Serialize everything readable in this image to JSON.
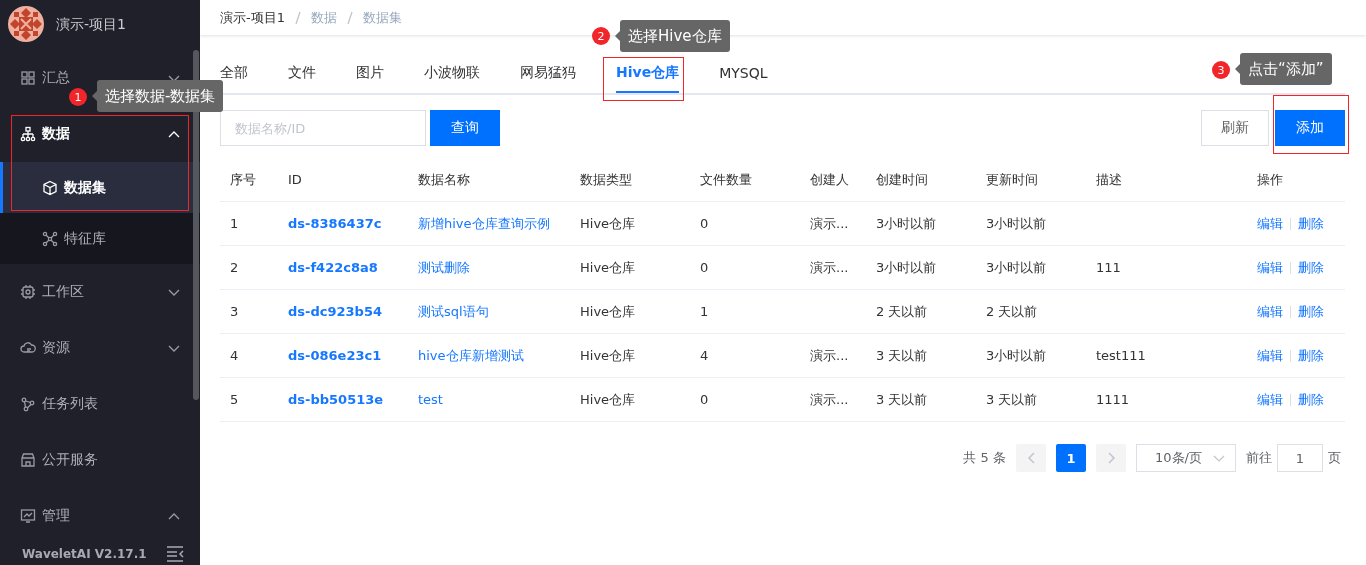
{
  "project": {
    "name": "演示-项目1"
  },
  "sidebar": {
    "items": [
      {
        "label": "汇总",
        "selected": false,
        "expanded": false
      },
      {
        "label": "数据",
        "selected": true,
        "expanded": true,
        "children": [
          {
            "label": "数据集",
            "selected": true
          },
          {
            "label": "特征库",
            "selected": false
          }
        ]
      },
      {
        "label": "工作区",
        "selected": false,
        "expanded": false
      },
      {
        "label": "资源",
        "selected": false,
        "expanded": false
      },
      {
        "label": "任务列表",
        "selected": false
      },
      {
        "label": "公开服务",
        "selected": false
      },
      {
        "label": "管理",
        "selected": false,
        "expanded": true
      }
    ],
    "version": "WaveletAI V2.17.1"
  },
  "breadcrumb": [
    "演示-项目1",
    "数据",
    "数据集"
  ],
  "tabs": [
    {
      "label": "全部",
      "selected": false
    },
    {
      "label": "文件",
      "selected": false
    },
    {
      "label": "图片",
      "selected": false
    },
    {
      "label": "小波物联",
      "selected": false
    },
    {
      "label": "网易猛犸",
      "selected": false
    },
    {
      "label": "Hive仓库",
      "selected": true
    },
    {
      "label": "MYSQL",
      "selected": false
    }
  ],
  "search": {
    "placeholder": "数据名称/ID",
    "button": "查询"
  },
  "toolbar": {
    "refresh": "刷新",
    "add": "添加"
  },
  "table": {
    "columns": [
      "序号",
      "ID",
      "数据名称",
      "数据类型",
      "文件数量",
      "创建人",
      "创建时间",
      "更新时间",
      "描述",
      "操作"
    ],
    "rows": [
      {
        "index": "1",
        "id": "ds-8386437c",
        "name": "新增hive仓库查询示例",
        "type": "Hive仓库",
        "files": "0",
        "creator": "演示...",
        "created": "3小时以前",
        "updated": "3小时以前",
        "actions": [
          "编辑",
          "删除"
        ]
      },
      {
        "index": "2",
        "id": "ds-f422c8a8",
        "name": "测试删除",
        "type": "Hive仓库",
        "files": "0",
        "creator": "演示...",
        "created": "3小时以前",
        "updated": "3小时以前",
        "description": "111",
        "actions": [
          "编辑",
          "删除"
        ]
      },
      {
        "index": "3",
        "id": "ds-dc923b54",
        "name": "测试sql语句",
        "type": "Hive仓库",
        "files": "1",
        "created": "2 天以前",
        "updated": "2 天以前",
        "actions": [
          "编辑",
          "删除"
        ]
      },
      {
        "index": "4",
        "id": "ds-086e23c1",
        "name": "hive仓库新增测试",
        "type": "Hive仓库",
        "files": "4",
        "creator": "演示...",
        "created": "3 天以前",
        "updated": "3小时以前",
        "description": "test111",
        "actions": [
          "编辑",
          "删除"
        ]
      },
      {
        "index": "5",
        "id": "ds-bb50513e",
        "name": "test",
        "type": "Hive仓库",
        "files": "0",
        "creator": "演示...",
        "created": "3 天以前",
        "updated": "3 天以前",
        "description": "1111",
        "actions": [
          "编辑",
          "删除"
        ]
      }
    ]
  },
  "pagination": {
    "total": "共 5 条",
    "pages": [
      {
        "label": "1",
        "selected": true
      }
    ],
    "page_size": "10条/页",
    "goto_label": "前往",
    "goto_value": "1",
    "goto_suffix": "页"
  },
  "annotations": [
    {
      "number": "1",
      "text": "选择数据-数据集"
    },
    {
      "number": "2",
      "text": "选择Hive仓库"
    },
    {
      "number": "3",
      "text": "点击“添加”"
    }
  ]
}
